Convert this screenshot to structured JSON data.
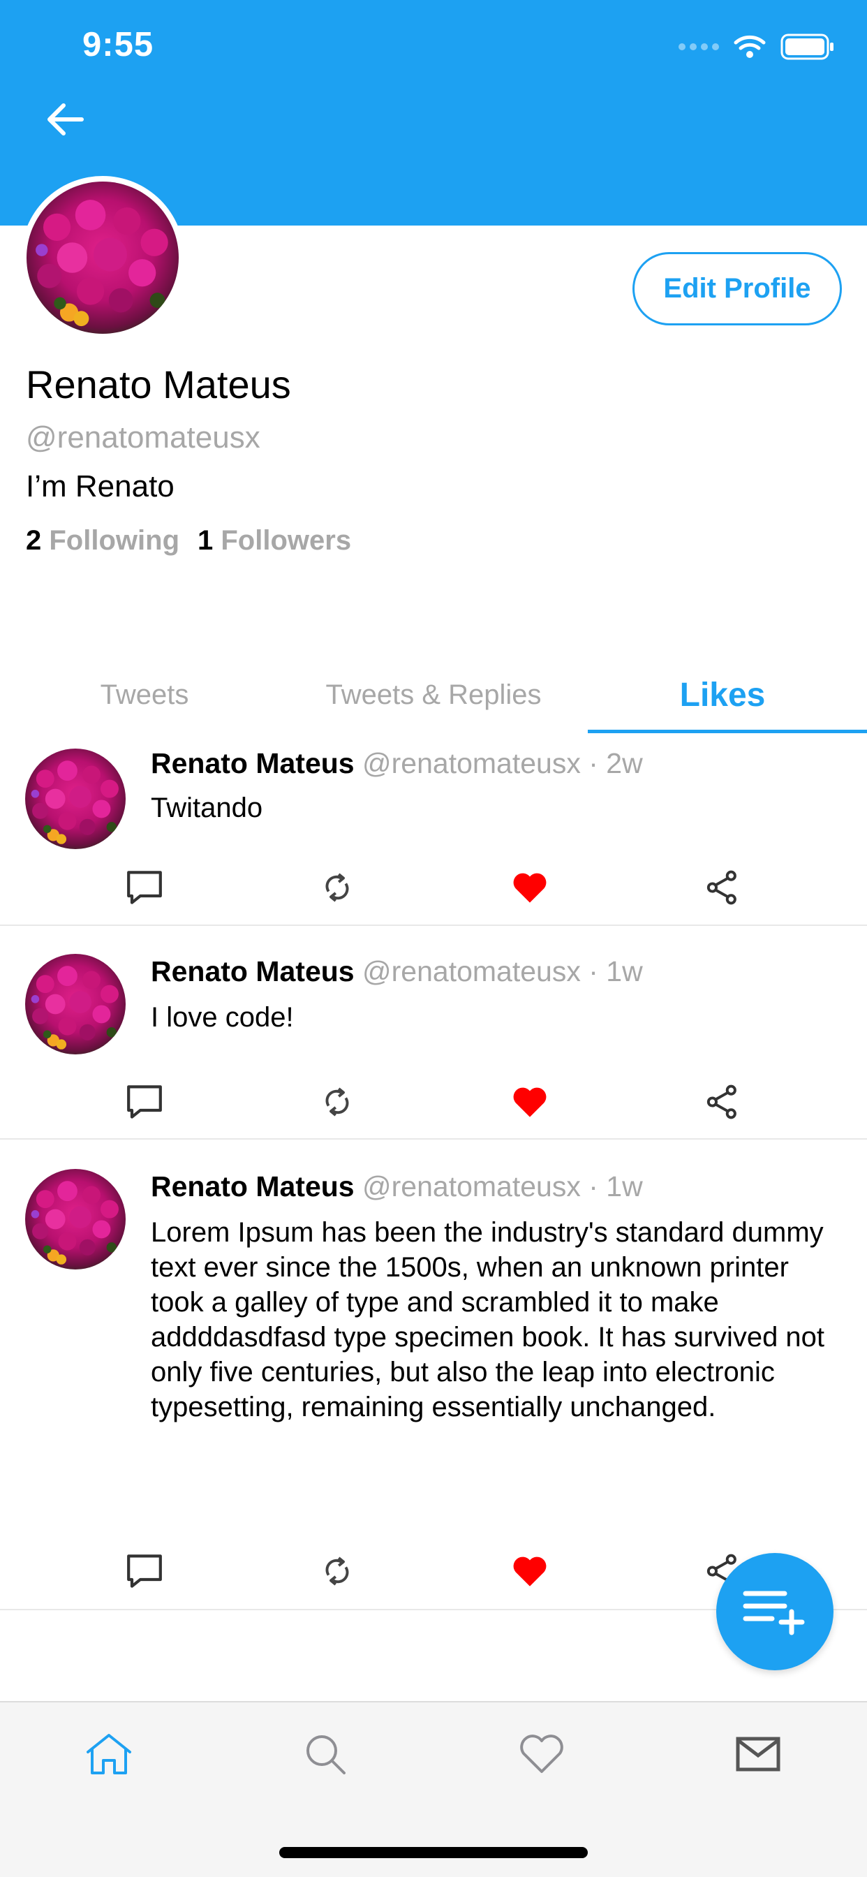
{
  "status_bar": {
    "time": "9:55"
  },
  "header": {
    "back_icon": "arrow-left-icon",
    "color": "#1da1f2"
  },
  "profile": {
    "name": "Renato Mateus",
    "handle": "@renatomateusx",
    "bio": "I’m Renato",
    "following_count": "2",
    "following_label": "Following",
    "followers_count": "1",
    "followers_label": "Followers",
    "edit_button": "Edit Profile"
  },
  "tabs": [
    {
      "label": "Tweets"
    },
    {
      "label": "Tweets & Replies"
    },
    {
      "label": "Likes"
    }
  ],
  "tweets": [
    {
      "name": "Renato Mateus",
      "meta": "@renatomateusx · 2w",
      "text": "Twitando",
      "liked": true
    },
    {
      "name": "Renato Mateus",
      "meta": "@renatomateusx · 1w",
      "text": "I love code!",
      "liked": true
    },
    {
      "name": "Renato Mateus",
      "meta": "@renatomateusx · 1w",
      "text": "Lorem Ipsum has been the industry's standard dummy text ever since the 1500s, when an unknown printer took a galley of type and scrambled it to make addddasdfasd type specimen book. It has survived not only five centuries, but also the leap into electronic typesetting, remaining essentially unchanged.",
      "liked": true
    }
  ],
  "fab": {
    "icon": "compose-tweet-icon"
  },
  "bottom_nav": [
    {
      "icon": "home-icon",
      "active": true
    },
    {
      "icon": "search-icon",
      "active": false
    },
    {
      "icon": "heart-icon",
      "active": false
    },
    {
      "icon": "mail-icon",
      "active": false
    }
  ],
  "colors": {
    "accent": "#1da1f2",
    "like": "#ff0000",
    "muted": "#a7a7a7"
  }
}
